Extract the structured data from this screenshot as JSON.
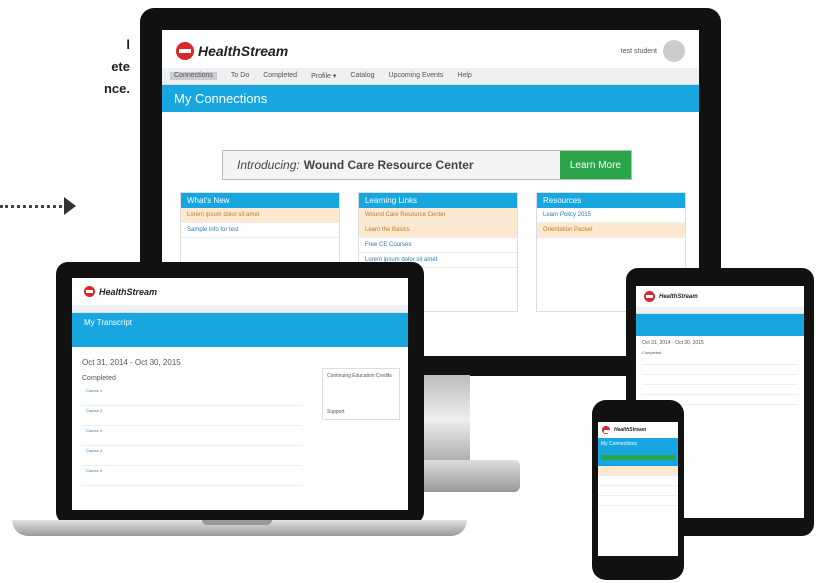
{
  "left_text": [
    "l",
    "ete",
    "",
    "nce."
  ],
  "brand": "HealthStream",
  "user": {
    "name": "test student"
  },
  "nav": [
    "Connections",
    "To Do",
    "Completed",
    "Profile ▾",
    "Catalog",
    "Upcoming Events",
    "Help"
  ],
  "page_title": "My Connections",
  "promo": {
    "prefix": "Introducing:",
    "title": "Wound Care Resource Center",
    "learn": "Learn More"
  },
  "panels": [
    {
      "title": "What's New",
      "rows": [
        "Lorem ipsum dolor sit amet",
        "Sample info for test"
      ]
    },
    {
      "title": "Learning Links",
      "rows": [
        "Wound Care Resource Center",
        "Learn the Basics",
        "Free CE Courses",
        "Lorem ipsum dolor sit amet"
      ]
    },
    {
      "title": "Resources",
      "rows": [
        "Learn Policy 2015",
        "Orientation Packet"
      ]
    }
  ],
  "laptop": {
    "title": "My Transcript",
    "date_range": "Oct 31, 2014 - Oct 30, 2015",
    "section": "Completed",
    "side_a": "Continuing Education Credits",
    "side_b": "Support",
    "rows": [
      "Course 1",
      "Course 2",
      "Course 3",
      "Course 4",
      "Course 5"
    ]
  },
  "tablet": {
    "date_range": "Oct 31, 2014 - Oct 30, 2015",
    "section": "Completed"
  },
  "phone": {
    "title": "My Connections"
  },
  "colors": {
    "primary": "#17a6e0",
    "brand_red": "#d8262b",
    "green": "#2aa54a"
  }
}
